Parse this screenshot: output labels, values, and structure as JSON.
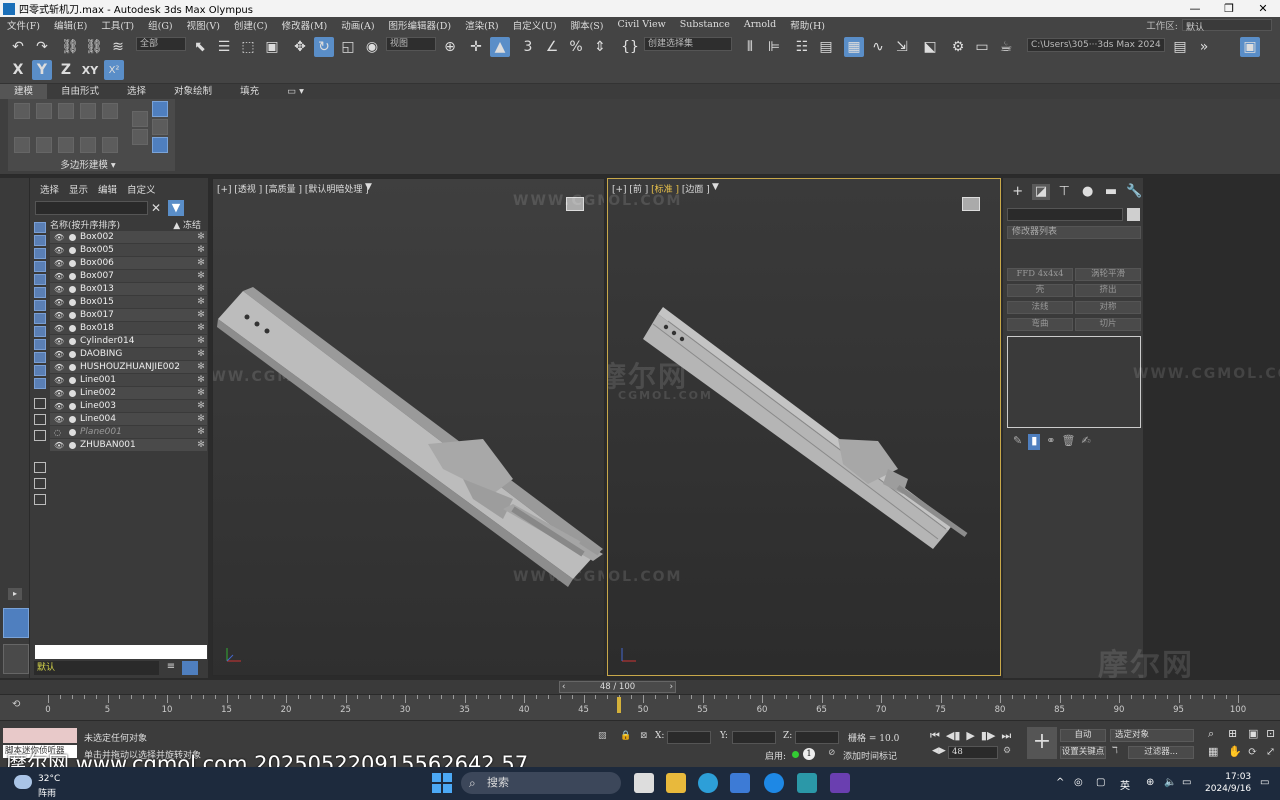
{
  "window": {
    "title": "四零式斩机刀.max - Autodesk 3ds Max Olympus"
  },
  "menu": {
    "items": [
      "文件(F)",
      "编辑(E)",
      "工具(T)",
      "组(G)",
      "视图(V)",
      "创建(C)",
      "修改器(M)",
      "动画(A)",
      "图形编辑器(D)",
      "渲染(R)",
      "自定义(U)",
      "脚本(S)",
      "Civil View",
      "Substance",
      "Arnold",
      "帮助(H)"
    ],
    "workspace_label": "工作区:",
    "workspace_value": "默认"
  },
  "toolbar": {
    "filter_select": "全部",
    "ref_coord_select": "视图",
    "selection_set": "创建选择集",
    "path_field": "C:\\Users\\305···3ds Max 2024",
    "axis_x": "X",
    "axis_y": "Y",
    "axis_z": "Z",
    "axis_xy": "XY"
  },
  "ribbon": {
    "tabs": [
      "建模",
      "自由形式",
      "选择",
      "对象绘制",
      "填充"
    ],
    "panel_caption": "多边形建模 ▾"
  },
  "explorer": {
    "tabs": [
      "选择",
      "显示",
      "编辑",
      "自定义"
    ],
    "header_name": "名称(按升序排序)",
    "header_freeze": "▲ 冻结",
    "layer": "默认",
    "objects": [
      {
        "name": "Box002",
        "hidden": false
      },
      {
        "name": "Box005",
        "hidden": false
      },
      {
        "name": "Box006",
        "hidden": false
      },
      {
        "name": "Box007",
        "hidden": false
      },
      {
        "name": "Box013",
        "hidden": false
      },
      {
        "name": "Box015",
        "hidden": false
      },
      {
        "name": "Box017",
        "hidden": false
      },
      {
        "name": "Box018",
        "hidden": false
      },
      {
        "name": "Cylinder014",
        "hidden": false
      },
      {
        "name": "DAOBING",
        "hidden": false
      },
      {
        "name": "HUSHOUZHUANJIE002",
        "hidden": false
      },
      {
        "name": "Line001",
        "hidden": false
      },
      {
        "name": "Line002",
        "hidden": false
      },
      {
        "name": "Line003",
        "hidden": false
      },
      {
        "name": "Line004",
        "hidden": false
      },
      {
        "name": "Plane001",
        "hidden": true
      },
      {
        "name": "ZHUBAN001",
        "hidden": false
      }
    ]
  },
  "viewports": {
    "left_label": "[+] [透视 ] [高质量 ] [默认明暗处理 ]",
    "right_label_a": "[+] [前 ] ",
    "right_label_b": "[标准 ]",
    "right_label_c": " [边面 ]",
    "watermark_en": "WWW.CGMOL.COM",
    "watermark_cn": "摩尔网",
    "watermark_sub": "CGMOL.COM"
  },
  "command_panel": {
    "modifier_list": "修改器列表",
    "buttons": [
      "FFD 4x4x4",
      "涡轮平滑",
      "壳",
      "挤出",
      "法线",
      "对称",
      "弯曲",
      "切片"
    ]
  },
  "timeline": {
    "frame_display": "48 / 100",
    "current_frame": 48,
    "total_frames": 100,
    "ticks": [
      0,
      5,
      10,
      15,
      20,
      25,
      30,
      35,
      40,
      45,
      50,
      55,
      60,
      65,
      70,
      75,
      80,
      85,
      90,
      95,
      100
    ]
  },
  "status": {
    "script_text": "脚本迷你侦听器",
    "selection_msg": "未选定任何对象",
    "hint_msg": "单击并拖动以选择并旋转对象",
    "x_label": "X:",
    "y_label": "Y:",
    "z_label": "Z:",
    "grid": "栅格 = 10.0",
    "enabled": "启用:",
    "add_time_tag": "添加时间标记",
    "frame_field": "48",
    "auto_key": "自动",
    "selected_obj": "选定对象",
    "set_key": "设置关键点",
    "key_filters": "过滤器..."
  },
  "overlay": {
    "site_text": "摩尔网 www.cgmol.com 202505220915562642 57"
  },
  "taskbar": {
    "temp": "32°C",
    "weather": "阵雨",
    "search": "搜索",
    "ime": "英",
    "time": "17:03",
    "date": "2024/9/16"
  }
}
